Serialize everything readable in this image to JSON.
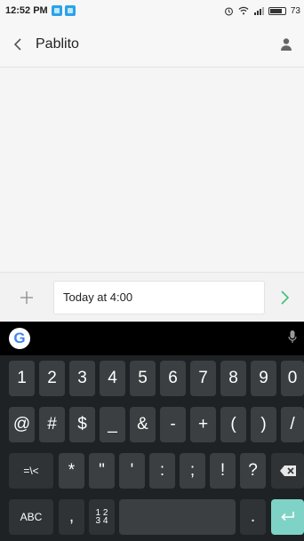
{
  "status_bar": {
    "time": "12:52 PM",
    "battery_pct": "73"
  },
  "header": {
    "title": "Pablito"
  },
  "compose": {
    "input_value": "Today at 4:00",
    "input_placeholder": ""
  },
  "keyboard": {
    "logo_letter": "G",
    "row_numbers": [
      "1",
      "2",
      "3",
      "4",
      "5",
      "6",
      "7",
      "8",
      "9",
      "0"
    ],
    "row_symbols1": [
      "@",
      "#",
      "$",
      "_",
      "&",
      "-",
      "+",
      "(",
      ")",
      "/"
    ],
    "row_symbols2": [
      "*",
      "\"",
      "'",
      ":",
      ";",
      "!",
      "?"
    ],
    "key_layout_switch": "=\\<",
    "key_abc": "ABC",
    "key_comma": ",",
    "key_numpad": "1 2\n3 4",
    "key_period": "."
  },
  "colors": {
    "accent_green": "#3fbf74",
    "enter_key": "#7ed3c6",
    "notif_blue": "#2aa3e8"
  }
}
